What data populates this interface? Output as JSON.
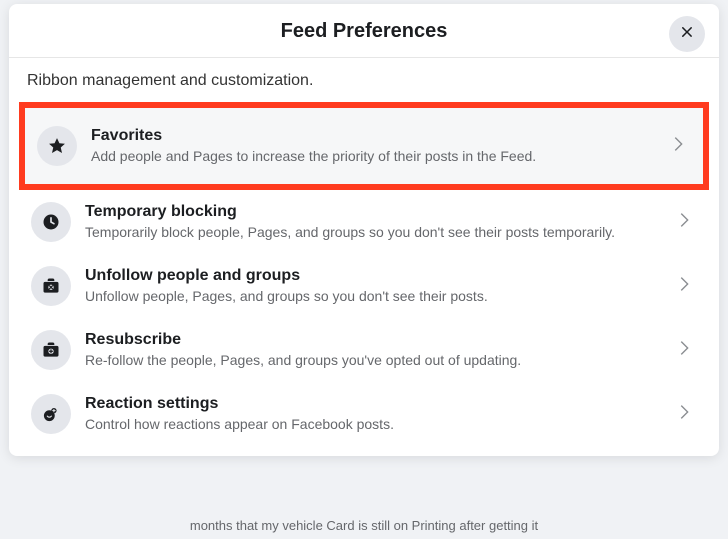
{
  "header": {
    "title": "Feed Preferences"
  },
  "subtitle": "Ribbon management and customization.",
  "items": [
    {
      "title": "Favorites",
      "desc": "Add people and Pages to increase the priority of their posts in the Feed."
    },
    {
      "title": "Temporary blocking",
      "desc": "Temporarily block people, Pages, and groups so you don't see their posts temporarily."
    },
    {
      "title": "Unfollow people and groups",
      "desc": "Unfollow people, Pages, and groups so you don't see their posts."
    },
    {
      "title": "Resubscribe",
      "desc": "Re-follow the people, Pages, and groups you've opted out of updating."
    },
    {
      "title": "Reaction settings",
      "desc": "Control how reactions appear on Facebook posts."
    }
  ],
  "background_text": "months that my vehicle Card is still on Printing after getting it"
}
